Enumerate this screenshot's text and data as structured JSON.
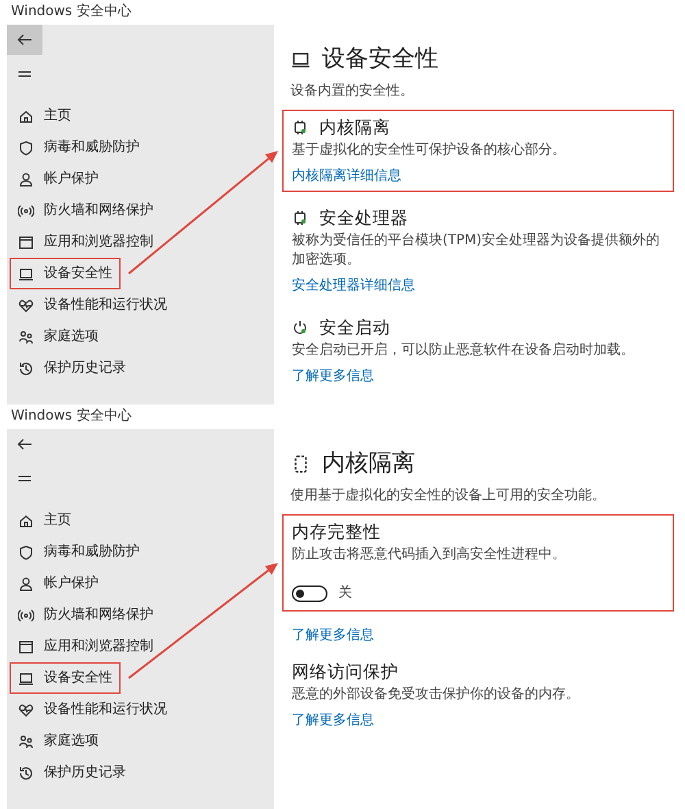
{
  "panels": [
    {
      "window": {
        "title": "Windows 安全中心"
      },
      "back_highlighted": true,
      "nav": [
        {
          "label": "主页",
          "annotated": false
        },
        {
          "label": "病毒和威胁防护",
          "annotated": false
        },
        {
          "label": "帐户保护",
          "annotated": false
        },
        {
          "label": "防火墙和网络保护",
          "annotated": false
        },
        {
          "label": "应用和浏览器控制",
          "annotated": false
        },
        {
          "label": "设备安全性",
          "annotated": true
        },
        {
          "label": "设备性能和运行状况",
          "annotated": false
        },
        {
          "label": "家庭选项",
          "annotated": false
        },
        {
          "label": "保护历史记录",
          "annotated": false
        }
      ],
      "page": {
        "title": "设备安全性",
        "subtitle": "设备内置的安全性。",
        "sections": [
          {
            "title": "内核隔离",
            "text": "基于虚拟化的安全性可保护设备的核心部分。",
            "link": "内核隔离详细信息",
            "annotated": true
          },
          {
            "title": "安全处理器",
            "text": "被称为受信任的平台模块(TPM)安全处理器为设备提供额外的加密选项。",
            "link": "安全处理器详细信息",
            "annotated": false
          },
          {
            "title": "安全启动",
            "text": "安全启动已开启，可以防止恶意软件在设备启动时加载。",
            "link": "了解更多信息",
            "annotated": false
          }
        ]
      }
    },
    {
      "window": {
        "title": "Windows 安全中心"
      },
      "back_highlighted": false,
      "nav": [
        {
          "label": "主页",
          "annotated": false
        },
        {
          "label": "病毒和威胁防护",
          "annotated": false
        },
        {
          "label": "帐户保护",
          "annotated": false
        },
        {
          "label": "防火墙和网络保护",
          "annotated": false
        },
        {
          "label": "应用和浏览器控制",
          "annotated": false
        },
        {
          "label": "设备安全性",
          "annotated": true
        },
        {
          "label": "设备性能和运行状况",
          "annotated": false
        },
        {
          "label": "家庭选项",
          "annotated": false
        },
        {
          "label": "保护历史记录",
          "annotated": false
        }
      ],
      "page": {
        "title": "内核隔离",
        "subtitle": "使用基于虚拟化的安全性的设备上可用的安全功能。",
        "sections": [
          {
            "title": "内存完整性",
            "text": "防止攻击将恶意代码插入到高安全性进程中。",
            "toggle": {
              "on": false,
              "label": "关"
            },
            "annotated": true
          },
          {
            "link": "了解更多信息",
            "annotated": false
          },
          {
            "title": "网络访问保护",
            "text": "恶意的外部设备免受攻击保护你的设备的内存。",
            "link": "了解更多信息",
            "annotated": false
          }
        ]
      }
    }
  ]
}
